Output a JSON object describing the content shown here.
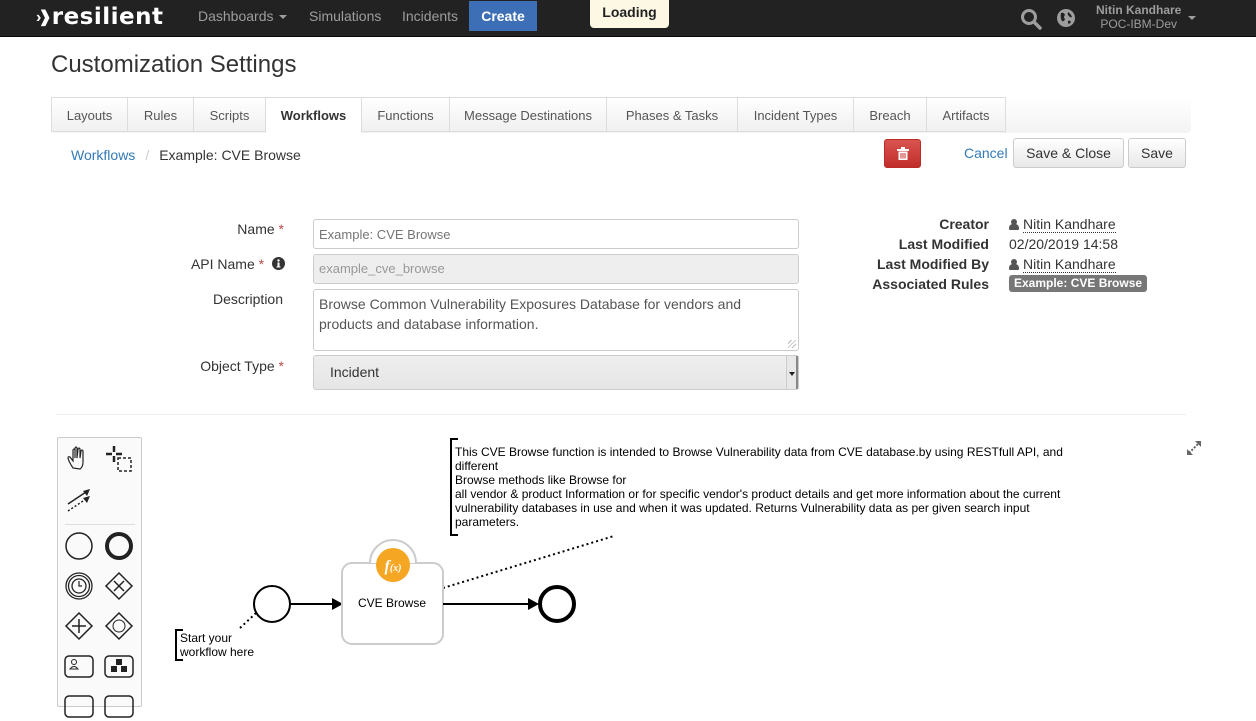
{
  "navbar": {
    "brand": "resilient",
    "links": [
      {
        "label": "Dashboards",
        "has_caret": true
      },
      {
        "label": "Simulations"
      },
      {
        "label": "Incidents"
      }
    ],
    "create_label": "Create",
    "loading_label": "Loading",
    "user": {
      "name": "Nitin Kandhare",
      "org": "POC-IBM-Dev"
    },
    "icons": [
      "search-icon",
      "globe-icon"
    ]
  },
  "page": {
    "title": "Customization Settings"
  },
  "tabs": [
    {
      "label": "Layouts"
    },
    {
      "label": "Rules"
    },
    {
      "label": "Scripts"
    },
    {
      "label": "Workflows",
      "active": true
    },
    {
      "label": "Functions"
    },
    {
      "label": "Message Destinations"
    },
    {
      "label": "Phases & Tasks"
    },
    {
      "label": "Incident Types"
    },
    {
      "label": "Breach"
    },
    {
      "label": "Artifacts"
    }
  ],
  "breadcrumb": {
    "parent": "Workflows",
    "separator": "/",
    "current": "Example: CVE Browse"
  },
  "actions": {
    "delete_icon": "trash-icon",
    "cancel": "Cancel",
    "save_close": "Save & Close",
    "save": "Save"
  },
  "form": {
    "name": {
      "label": "Name",
      "required": "*",
      "placeholder": "Example: CVE Browse",
      "value": ""
    },
    "api_name": {
      "label": "API Name",
      "required": "*",
      "value": "example_cve_browse"
    },
    "description": {
      "label": "Description",
      "value": "Browse Common Vulnerability Exposures Database for vendors and products and database information."
    },
    "object_type": {
      "label": "Object Type",
      "required": "*",
      "value": "Incident"
    }
  },
  "meta": {
    "creator_label": "Creator",
    "creator": "Nitin Kandhare",
    "last_modified_label": "Last Modified",
    "last_modified": "02/20/2019 14:58",
    "last_modified_by_label": "Last Modified By",
    "last_modified_by": "Nitin Kandhare",
    "associated_rules_label": "Associated Rules",
    "associated_rules": [
      "Example: CVE Browse"
    ]
  },
  "diagram": {
    "start_annotation": [
      "Start your",
      "workflow here"
    ],
    "task_label": "CVE Browse",
    "task_icon": "f(x)",
    "annotation_lines": [
      "This CVE Browse function is intended to Browse Vulnerability data from CVE database.by using RESTfull API, and",
      "different",
      "Browse methods like Browse for",
      "all vendor & product Information or for specific vendor's product details and get more information about the current",
      "vulnerability databases in use and when it was updated. Returns Vulnerability data as per given search input",
      "parameters."
    ]
  },
  "colors": {
    "navbar": "#222222",
    "create": "#3d6fb6",
    "danger": "#d9534f",
    "link": "#337ab7",
    "function_badge": "#f5a623"
  }
}
